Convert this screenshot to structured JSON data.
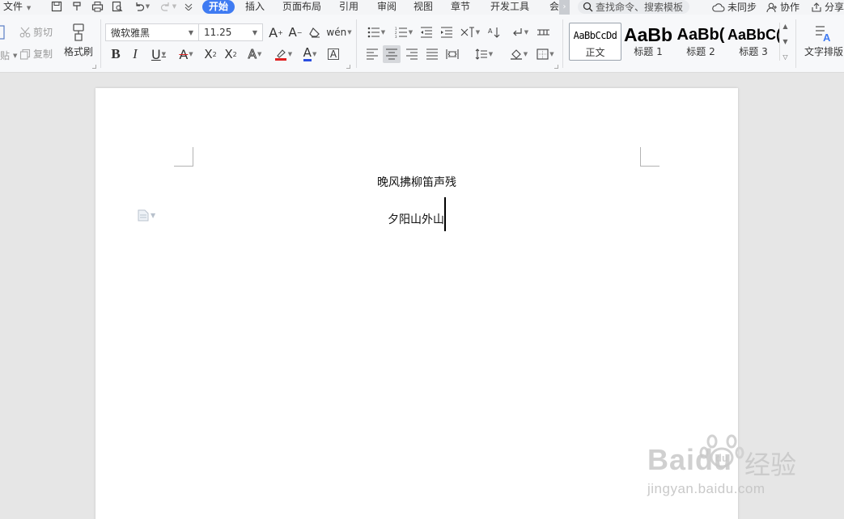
{
  "tabs": {
    "file": "文件",
    "items": [
      "开始",
      "插入",
      "页面布局",
      "引用",
      "审阅",
      "视图",
      "章节",
      "开发工具",
      "会"
    ],
    "active_index": 0,
    "search_placeholder": "查找命令、搜索模板",
    "unsynced": "未同步",
    "collab": "协作",
    "share": "分享"
  },
  "clipboard": {
    "cut": "剪切",
    "copy": "复制",
    "format_painter": "格式刷",
    "paste_partial": "贴"
  },
  "font": {
    "name": "微软雅黑",
    "size": "11.25"
  },
  "styles": {
    "items": [
      {
        "preview": "AaBbCcDd",
        "label": "正文"
      },
      {
        "preview": "AaBb",
        "label": "标题 1"
      },
      {
        "preview": "AaBb(",
        "label": "标题 2"
      },
      {
        "preview": "AaBbC(",
        "label": "标题 3"
      }
    ]
  },
  "text_layout": "文字排版",
  "document": {
    "line1": "晚风拂柳笛声残",
    "line2": "夕阳山外山"
  },
  "watermark": {
    "brand": "Baidu",
    "cn": "经验",
    "url": "jingyan.baidu.com"
  },
  "colors": {
    "accent": "#3f7bf2",
    "highlight_red": "#e02020",
    "font_color_blue": "#2a4ee0"
  }
}
